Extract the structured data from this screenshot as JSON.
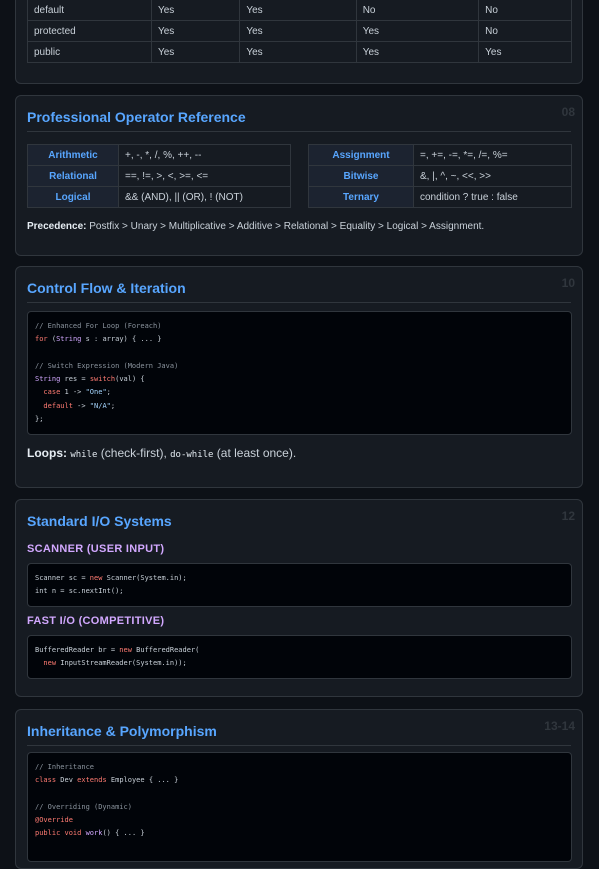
{
  "access_table": {
    "rows": [
      [
        "default",
        "Yes",
        "Yes",
        "No",
        "No"
      ],
      [
        "protected",
        "Yes",
        "Yes",
        "Yes",
        "No"
      ],
      [
        "public",
        "Yes",
        "Yes",
        "Yes",
        "Yes"
      ]
    ]
  },
  "operators": {
    "title": "Professional Operator Reference",
    "number": "08",
    "left": [
      {
        "category": "Arithmetic",
        "ops": "+, -, *, /, %, ++, --"
      },
      {
        "category": "Relational",
        "ops": "==, !=, >, <, >=, <="
      },
      {
        "category": "Logical",
        "ops": "&& (AND), || (OR), ! (NOT)"
      }
    ],
    "right": [
      {
        "category": "Assignment",
        "ops": "=, +=, -=, *=, /=, %="
      },
      {
        "category": "Bitwise",
        "ops": "&, |, ^, ~, <<, >>"
      },
      {
        "category": "Ternary",
        "ops": "condition ? true : false"
      }
    ],
    "precedence_label": "Precedence:",
    "precedence_text": "Postfix > Unary > Multiplicative > Additive > Relational > Equality > Logical > Assignment."
  },
  "control_flow": {
    "title": "Control Flow & Iteration",
    "number": "10",
    "code": {
      "l1": "// Enhanced For Loop (Foreach)",
      "l2_kw": "for",
      "l2_a": " (",
      "l2_ty": "String",
      "l2_b": " s : array) { ... }",
      "l4": "// Switch Expression (Modern Java)",
      "l5_ty": "String",
      "l5_a": " res = ",
      "l5_kw": "switch",
      "l5_b": "(val) {",
      "l6_kw": "  case",
      "l6_a": " 1 -> ",
      "l6_st": "\"One\"",
      "l6_b": ";",
      "l7_kw": "  default",
      "l7_a": " -> ",
      "l7_st": "\"N/A\"",
      "l7_b": ";",
      "l8": "};"
    },
    "loops_label": "Loops:",
    "loops_while": "while",
    "loops_while_desc": " (check-first), ",
    "loops_dowhile": "do-while",
    "loops_dowhile_desc": " (at least once)."
  },
  "io": {
    "title": "Standard I/O Systems",
    "number": "12",
    "scanner_heading": "SCANNER (USER INPUT)",
    "scanner_code": {
      "l1_a": "Scanner sc = ",
      "l1_kw": "new",
      "l1_b": " Scanner(System.in);",
      "l2": "int n = sc.nextInt();"
    },
    "fast_heading": "FAST I/O (COMPETITIVE)",
    "fast_code": {
      "l1_a": "BufferedReader br = ",
      "l1_kw": "new",
      "l1_b": " BufferedReader(",
      "l2_kw": "  new",
      "l2_b": " InputStreamReader(System.in));"
    }
  },
  "inheritance": {
    "title": "Inheritance & Polymorphism",
    "number": "13-14",
    "code": {
      "l1": "// Inheritance",
      "l2_kw": "class",
      "l2_a": " Dev ",
      "l2_kw2": "extends",
      "l2_b": " Employee { ... }",
      "l4": "// Overriding (Dynamic)",
      "l5": "@Override",
      "l6_kw": "public void",
      "l6_a": " ",
      "l6_fn": "work",
      "l6_b": "() { ... }"
    }
  }
}
